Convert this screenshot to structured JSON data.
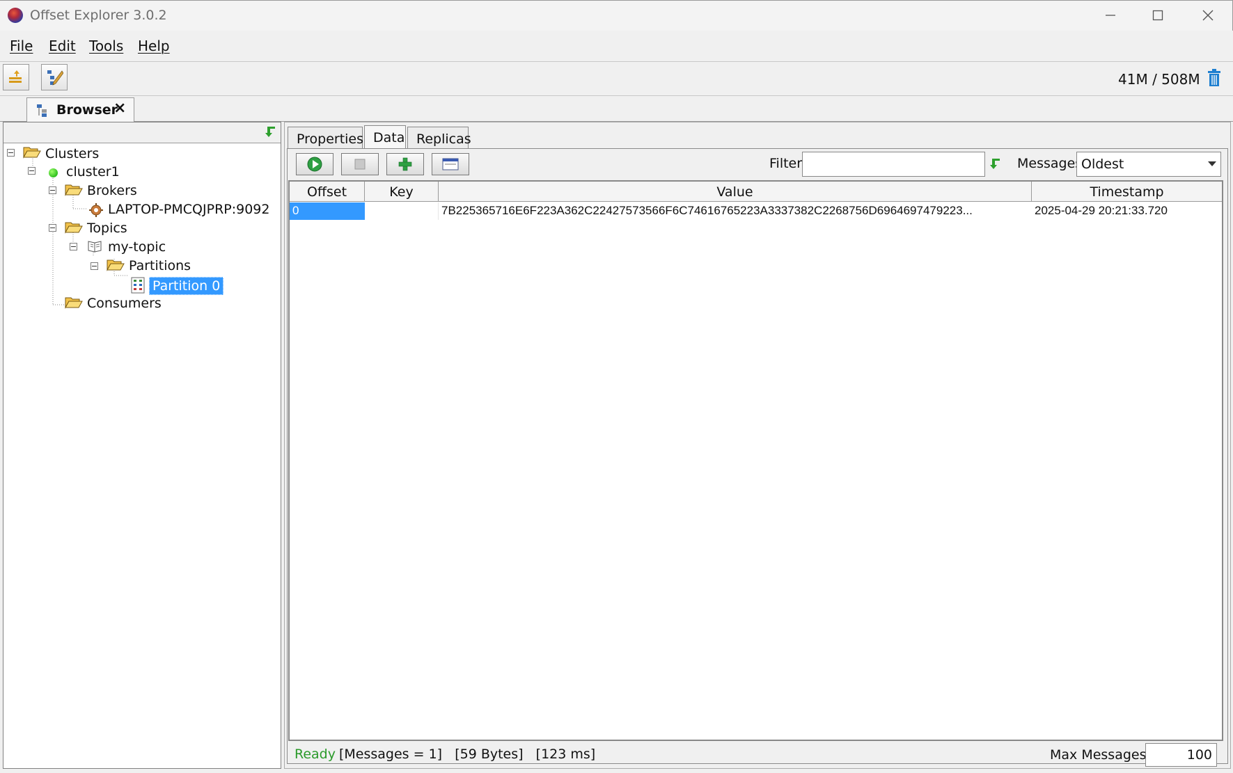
{
  "window": {
    "title": "Offset Explorer  3.0.2"
  },
  "menu": {
    "items": [
      {
        "label": "File"
      },
      {
        "label": "Edit"
      },
      {
        "label": "Tools"
      },
      {
        "label": "Help"
      }
    ]
  },
  "toolbar": {
    "memory": "41M / 508M"
  },
  "main_tab": {
    "label": "Browser",
    "close": "×"
  },
  "tree": {
    "clusters": "Clusters",
    "cluster1": "cluster1",
    "brokers": "Brokers",
    "broker1": "LAPTOP-PMCQJPRP:9092",
    "topics": "Topics",
    "topic1": "my-topic",
    "partitions": "Partitions",
    "partition0": "Partition 0",
    "consumers": "Consumers"
  },
  "detail_tabs": [
    {
      "label": "Properties"
    },
    {
      "label": "Data"
    },
    {
      "label": "Replicas"
    }
  ],
  "data_toolbar": {
    "filter_label": "Filter",
    "filter_value": "",
    "messages_label": "Messages",
    "messages_selected": "Oldest"
  },
  "table": {
    "columns": [
      "Offset",
      "Key",
      "Value",
      "Timestamp"
    ],
    "rows": [
      {
        "offset": "0",
        "key": "",
        "value": "7B225365716E6F223A362C22427573566F6C74616765223A3337382C2268756D6964697479223...",
        "timestamp": "2025-04-29 20:21:33.720"
      }
    ]
  },
  "status": {
    "ready": "Ready",
    "info": "[Messages = 1]   [59 Bytes]   [123 ms]",
    "max_messages_label": "Max Messages",
    "max_messages_value": "100"
  },
  "colors": {
    "selection": "#3399ff",
    "ready": "#2a9a2a",
    "trash": "#1e7fd0"
  }
}
